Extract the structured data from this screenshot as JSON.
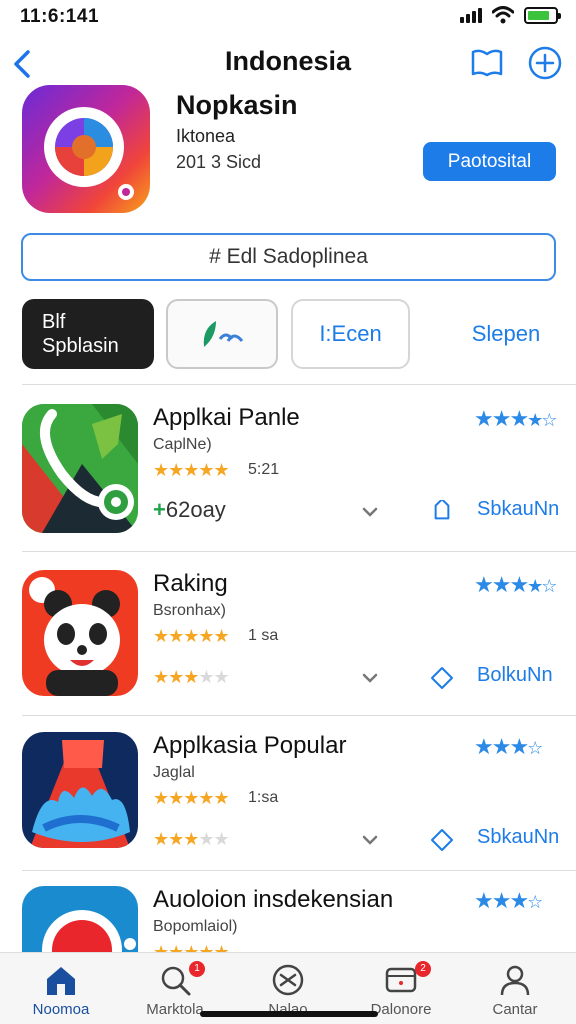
{
  "status": {
    "time": "11:6:141"
  },
  "nav": {
    "title": "Indonesia"
  },
  "featured": {
    "title": "Nopkasin",
    "subtitle": "Iktonea",
    "meta": "201 3 Sicd",
    "button": "Paotosital"
  },
  "search": {
    "text": "# Edl Sadoplinea"
  },
  "chips": [
    {
      "line1": "Blf",
      "line2": "Spblasin"
    },
    {
      "label": ""
    },
    {
      "label": "I:Ecen"
    },
    {
      "label": "Slepen"
    }
  ],
  "apps": [
    {
      "title": "Applkai Panle",
      "subtitle": "CaplNe)",
      "count": "5:21",
      "price": "62oay",
      "action": "SbkauNn"
    },
    {
      "title": "Raking",
      "subtitle": "Bsronhax)",
      "count": "1 sa",
      "action": "BolkuNn"
    },
    {
      "title": "Applkasia Popular",
      "subtitle": "Jaglal",
      "count": "1:sa",
      "action": "SbkauNn"
    },
    {
      "title": "Auoloion insdekensian",
      "subtitle": "Bopomlaiol)"
    }
  ],
  "tabs": [
    {
      "label": "Noomoa",
      "icon": "home-icon"
    },
    {
      "label": "Marktola",
      "icon": "search-icon",
      "badge": "1"
    },
    {
      "label": "Nalao",
      "icon": "games-icon"
    },
    {
      "label": "Dalonore",
      "icon": "updates-icon",
      "badge": "2"
    },
    {
      "label": "Cantar",
      "icon": "profile-icon"
    }
  ],
  "colors": {
    "accent": "#1d7ce8",
    "star": "#f5a623",
    "rating": "#2b8ae6",
    "badge": "#e8262b"
  }
}
